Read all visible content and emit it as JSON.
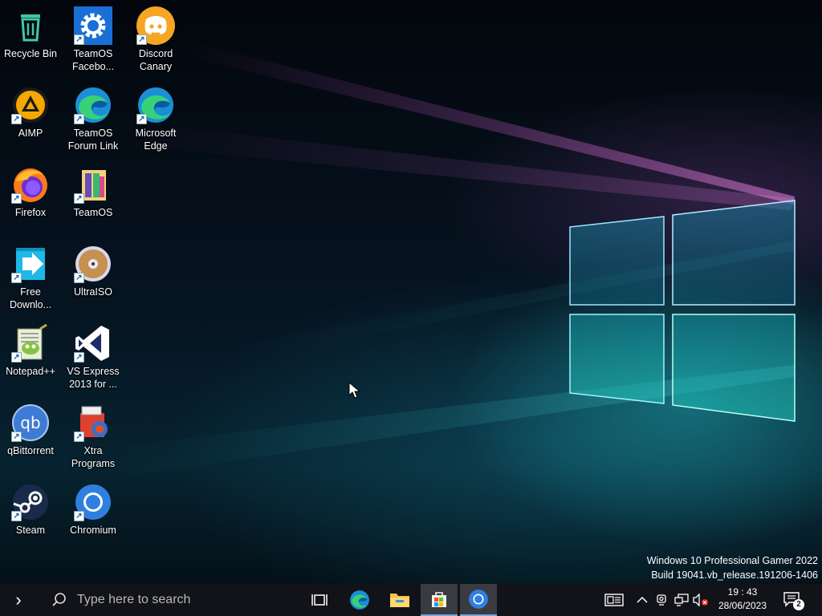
{
  "desktop_icons": [
    {
      "label": "Recycle Bin",
      "icon": "recycle-bin-icon",
      "shortcut": false
    },
    {
      "label": "TeamOS Facebo...",
      "icon": "gear-settings-icon",
      "shortcut": true
    },
    {
      "label": "Discord Canary",
      "icon": "discord-icon",
      "shortcut": true
    },
    {
      "label": "AIMP",
      "icon": "aimp-icon",
      "shortcut": true
    },
    {
      "label": "TeamOS Forum Link",
      "icon": "edge-icon",
      "shortcut": true
    },
    {
      "label": "Microsoft Edge",
      "icon": "edge-icon",
      "shortcut": true
    },
    {
      "label": "Firefox",
      "icon": "firefox-icon",
      "shortcut": true
    },
    {
      "label": "TeamOS",
      "icon": "teamos-icon",
      "shortcut": true
    },
    {
      "label": "Free Downlo...",
      "icon": "free-download-manager-icon",
      "shortcut": true
    },
    {
      "label": "UltraISO",
      "icon": "ultraiso-disc-icon",
      "shortcut": true
    },
    {
      "label": "Notepad++",
      "icon": "notepad-plus-plus-icon",
      "shortcut": true
    },
    {
      "label": "VS Express 2013 for ...",
      "icon": "visual-studio-icon",
      "shortcut": true
    },
    {
      "label": "qBittorrent",
      "icon": "qbittorrent-icon",
      "shortcut": true
    },
    {
      "label": "Xtra Programs",
      "icon": "xtra-programs-icon",
      "shortcut": true
    },
    {
      "label": "Steam",
      "icon": "steam-icon",
      "shortcut": true
    },
    {
      "label": "Chromium",
      "icon": "chromium-icon",
      "shortcut": true
    }
  ],
  "watermark": {
    "line1": "Windows 10 Professional Gamer 2022",
    "line2": "Build 19041.vb_release.191206-1406"
  },
  "taskbar": {
    "start_glyph": "›",
    "search_placeholder": "Type here to search",
    "clock_time": "19 : 43",
    "clock_date": "28/06/2023",
    "notification_count": "2",
    "pinned": [
      "task-view",
      "microsoft-edge",
      "file-explorer",
      "microsoft-store",
      "chromium"
    ],
    "tray": [
      "news-and-interests",
      "show-hidden-icons",
      "webcam-status",
      "network",
      "volume-muted"
    ]
  },
  "colors": {
    "taskbar_bg": "#121318",
    "accent": "#7aa6da"
  }
}
